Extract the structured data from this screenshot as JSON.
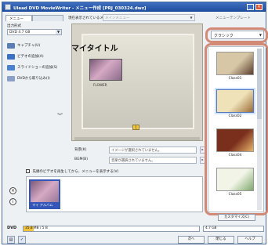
{
  "window": {
    "title": "Ulead DVD MovieWriter - メニュー作成 [PRJ_030324.dwz]",
    "min_glyph": "_",
    "close_glyph": "✕"
  },
  "tabs": [
    {
      "label": "メニュー"
    },
    {
      "label": ""
    }
  ],
  "menu_now": {
    "label": "現在表示されているメニュー",
    "value": "メインメニュー"
  },
  "template_panel": {
    "label": "メニューテンプレート",
    "selected": "クラシック",
    "items": [
      {
        "name": "Class01",
        "colors": [
          "#d7c7a6",
          "#5a3d2c"
        ]
      },
      {
        "name": "Class02",
        "colors": [
          "#efe1b8",
          "#9a6b34"
        ]
      },
      {
        "name": "Class04",
        "colors": [
          "#7a2e1c",
          "#e8b46a"
        ]
      },
      {
        "name": "Class05",
        "colors": [
          "#f1f4e6",
          "#7fa86d"
        ]
      }
    ],
    "edit_button": "カスタマイズ(C)"
  },
  "left_panel": {
    "output_label": "出力形式",
    "output_value": "DVD 4.7 GB",
    "items": [
      {
        "label": "キャプチャ(U)",
        "icon": "capture-icon"
      },
      {
        "label": "ビデオの追加(A)",
        "icon": "add-video-icon"
      },
      {
        "label": "スライドショーの追加(S)",
        "icon": "add-slideshow-icon"
      },
      {
        "label": "DVDから取り込み(I)",
        "icon": "import-dvd-icon"
      }
    ]
  },
  "preview": {
    "menu_title": "マイタイトル",
    "thumb_label": "FLOWER",
    "page_button": "1"
  },
  "lower": {
    "background_label": "背景(K)",
    "background_value": "イメージが選択されていません。",
    "bgm_label": "BGM(B)",
    "bgm_value": "音楽が選択されていません。",
    "autoplay_label": "先頭のビデオを再生してから、メニューを表示する(V)",
    "menu_item_label": "マイ アルバム"
  },
  "disc": {
    "label": "DVD",
    "used": "35.8 MB / 5 B",
    "used_fraction": 0.06,
    "capacity": "4.7 GB"
  },
  "footer": {
    "next": "次へ",
    "close": "閉じる",
    "help": "ヘルプ"
  }
}
